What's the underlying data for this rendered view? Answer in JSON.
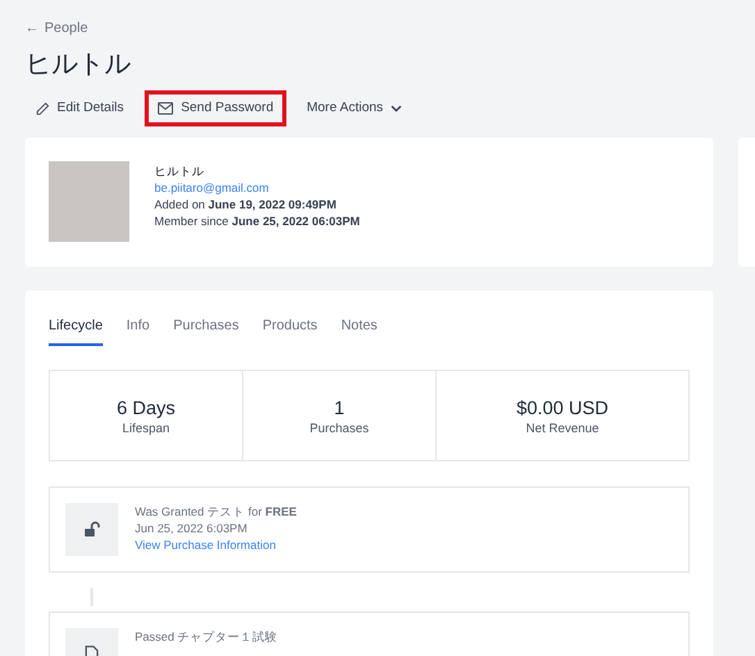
{
  "back_link": {
    "icon": "←",
    "label": "People"
  },
  "title": "ヒルトル",
  "actions": [
    {
      "kind": "edit",
      "label": "Edit Details",
      "highlighted": false
    },
    {
      "kind": "mail",
      "label": "Send Password",
      "highlighted": true
    },
    {
      "kind": "menu",
      "label": "More Actions",
      "highlighted": false
    }
  ],
  "profile": {
    "name": "ヒルトル",
    "email": "be.piitaro@gmail.com",
    "added": "Added on **June 19, 2022 09:49PM**",
    "member_since": "Member since **June 25, 2022 06:03PM**"
  },
  "tabs": [
    {
      "label": "Lifecycle",
      "selected": true
    },
    {
      "label": "Info",
      "selected": false
    },
    {
      "label": "Purchases",
      "selected": false
    },
    {
      "label": "Products",
      "selected": false
    },
    {
      "label": "Notes",
      "selected": false
    }
  ],
  "stats": [
    {
      "value": "6 Days",
      "label": "Lifespan"
    },
    {
      "value": "1",
      "label": "Purchases"
    },
    {
      "value": "$0.00 USD",
      "label": "Net Revenue"
    }
  ],
  "events": [
    {
      "kind": "unlock",
      "title": "Was Granted テスト for **FREE**",
      "date": "Jun 25, 2022 6:03PM",
      "link": "View Purchase Information"
    },
    {
      "kind": "document",
      "title": "Passed チャプター１試験"
    }
  ]
}
